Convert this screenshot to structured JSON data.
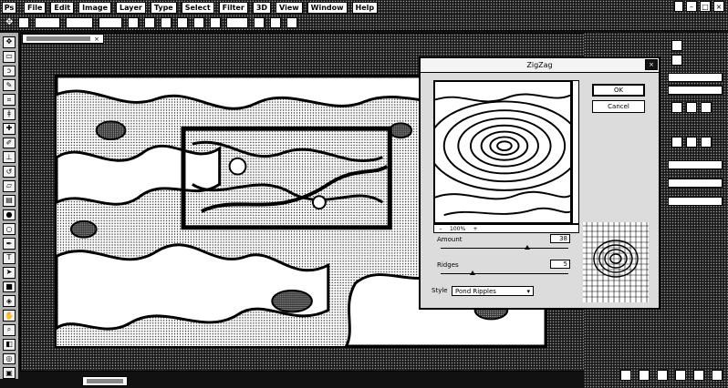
{
  "app": {
    "logo": "Ps"
  },
  "menubar": {
    "items": [
      "File",
      "Edit",
      "Image",
      "Layer",
      "Type",
      "Select",
      "Filter",
      "3D",
      "View",
      "Window",
      "Help"
    ],
    "window_buttons": [
      "–",
      "□",
      "×"
    ]
  },
  "document": {
    "tab_close": "×"
  },
  "dialog": {
    "title": "ZigZag",
    "close": "×",
    "ok_label": "OK",
    "cancel_label": "Cancel",
    "zoom_minus": "–",
    "zoom_value": "100%",
    "zoom_plus": "+",
    "amount": {
      "label": "Amount",
      "value": "38",
      "fraction": 0.68
    },
    "ridges": {
      "label": "Ridges",
      "value": "5",
      "fraction": 0.25
    },
    "style": {
      "label": "Style",
      "value": "Pond Ripples",
      "arrow": "▾"
    }
  }
}
